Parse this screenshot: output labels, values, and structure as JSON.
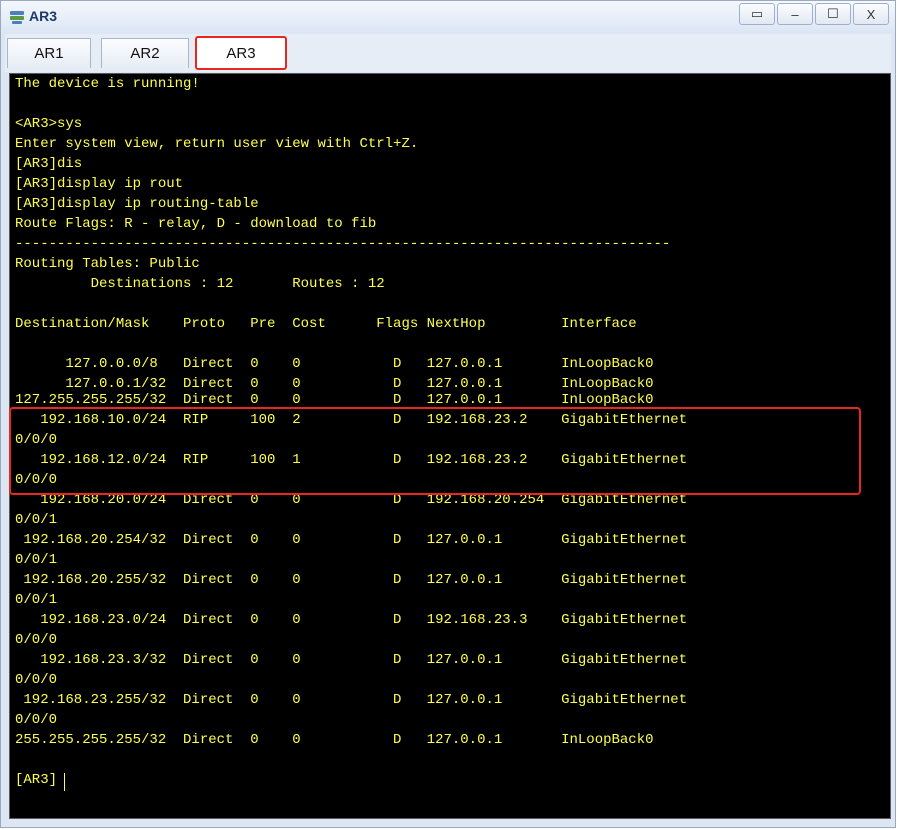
{
  "window": {
    "title": "AR3",
    "buttons": [
      "▭",
      "–",
      "☐",
      "X"
    ]
  },
  "tabs": [
    {
      "label": "AR1",
      "active": false
    },
    {
      "label": "AR2",
      "active": false
    },
    {
      "label": "AR3",
      "active": true
    }
  ],
  "terminal": {
    "lines": [
      "The device is running!",
      "",
      "<AR3>sys",
      "Enter system view, return user view with Ctrl+Z.",
      "[AR3]dis",
      "[AR3]display ip rout",
      "[AR3]display ip routing-table",
      "Route Flags: R - relay, D - download to fib",
      "------------------------------------------------------------------------------",
      "Routing Tables: Public",
      "         Destinations : 12       Routes : 12",
      "",
      "Destination/Mask    Proto   Pre  Cost      Flags NextHop         Interface",
      "",
      "      127.0.0.0/8   Direct  0    0           D   127.0.0.1       InLoopBack0",
      "      127.0.0.1/32  Direct  0    0           D   127.0.0.1       InLoopBack0",
      "127.255.255.255/32  Direct  0    0           D   127.0.0.1       InLoopBack0",
      "   192.168.10.0/24  RIP     100  2           D   192.168.23.2    GigabitEthernet",
      "0/0/0",
      "   192.168.12.0/24  RIP     100  1           D   192.168.23.2    GigabitEthernet",
      "0/0/0",
      "   192.168.20.0/24  Direct  0    0           D   192.168.20.254  GigabitEthernet",
      "0/0/1",
      " 192.168.20.254/32  Direct  0    0           D   127.0.0.1       GigabitEthernet",
      "0/0/1",
      " 192.168.20.255/32  Direct  0    0           D   127.0.0.1       GigabitEthernet",
      "0/0/1",
      "   192.168.23.0/24  Direct  0    0           D   192.168.23.3    GigabitEthernet",
      "0/0/0",
      "   192.168.23.3/32  Direct  0    0           D   127.0.0.1       GigabitEthernet",
      "0/0/0",
      " 192.168.23.255/32  Direct  0    0           D   127.0.0.1       GigabitEthernet",
      "0/0/0",
      "255.255.255.255/32  Direct  0    0           D   127.0.0.1       InLoopBack0",
      "",
      "[AR3]"
    ]
  },
  "colors": {
    "terminal_text": "#ffff50",
    "terminal_bg": "#000000",
    "highlight": "#e8271f"
  }
}
